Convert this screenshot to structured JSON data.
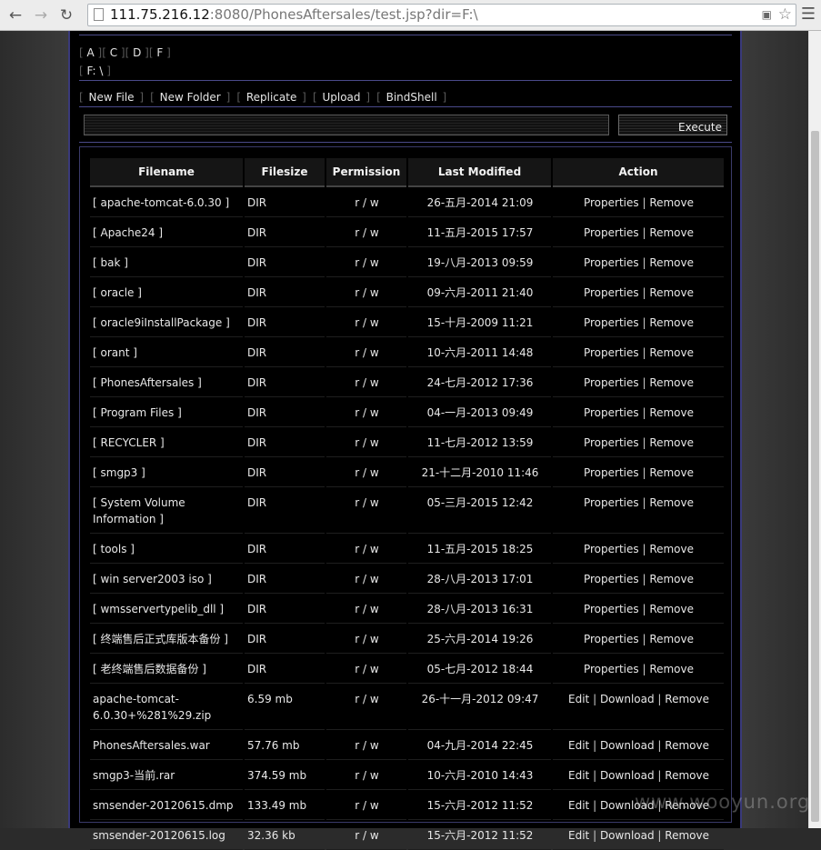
{
  "browser": {
    "url_host": "111.75.216.12",
    "url_rest": ":8080/PhonesAftersales/test.jsp?dir=F:\\",
    "back_icon": "back-arrow-icon",
    "forward_icon": "forward-arrow-icon",
    "reload_icon": "reload-icon",
    "menu_icon": "menu-icon"
  },
  "drives": [
    "A",
    "C",
    "D",
    "F"
  ],
  "current_dir": "F: \\",
  "toolbar": {
    "new_file": "New File",
    "new_folder": "New Folder",
    "replicate": "Replicate",
    "upload": "Upload",
    "bindshell": "BindShell"
  },
  "command": {
    "value": "",
    "execute_label": "Execute"
  },
  "table": {
    "headers": [
      "Filename",
      "Filesize",
      "Permission",
      "Last Modified",
      "Action"
    ],
    "rows": [
      {
        "name": "[ apache-tomcat-6.0.30 ]",
        "size": "DIR",
        "perm": "r / w",
        "modified": "26-五月-2014 21:09",
        "actions": [
          "Properties",
          "Remove"
        ]
      },
      {
        "name": "[ Apache24 ]",
        "size": "DIR",
        "perm": "r / w",
        "modified": "11-五月-2015 17:57",
        "actions": [
          "Properties",
          "Remove"
        ]
      },
      {
        "name": "[ bak ]",
        "size": "DIR",
        "perm": "r / w",
        "modified": "19-八月-2013 09:59",
        "actions": [
          "Properties",
          "Remove"
        ]
      },
      {
        "name": "[ oracle ]",
        "size": "DIR",
        "perm": "r / w",
        "modified": "09-六月-2011 21:40",
        "actions": [
          "Properties",
          "Remove"
        ]
      },
      {
        "name": "[ oracle9iInstallPackage ]",
        "size": "DIR",
        "perm": "r / w",
        "modified": "15-十月-2009 11:21",
        "actions": [
          "Properties",
          "Remove"
        ]
      },
      {
        "name": "[ orant ]",
        "size": "DIR",
        "perm": "r / w",
        "modified": "10-六月-2011 14:48",
        "actions": [
          "Properties",
          "Remove"
        ]
      },
      {
        "name": "[ PhonesAftersales ]",
        "size": "DIR",
        "perm": "r / w",
        "modified": "24-七月-2012 17:36",
        "actions": [
          "Properties",
          "Remove"
        ]
      },
      {
        "name": "[ Program Files ]",
        "size": "DIR",
        "perm": "r / w",
        "modified": "04-一月-2013 09:49",
        "actions": [
          "Properties",
          "Remove"
        ]
      },
      {
        "name": "[ RECYCLER ]",
        "size": "DIR",
        "perm": "r / w",
        "modified": "11-七月-2012 13:59",
        "actions": [
          "Properties",
          "Remove"
        ]
      },
      {
        "name": "[ smgp3 ]",
        "size": "DIR",
        "perm": "r / w",
        "modified": "21-十二月-2010 11:46",
        "actions": [
          "Properties",
          "Remove"
        ]
      },
      {
        "name": "[ System Volume Information ]",
        "size": "DIR",
        "perm": "r / w",
        "modified": "05-三月-2015 12:42",
        "actions": [
          "Properties",
          "Remove"
        ]
      },
      {
        "name": "[ tools ]",
        "size": "DIR",
        "perm": "r / w",
        "modified": "11-五月-2015 18:25",
        "actions": [
          "Properties",
          "Remove"
        ]
      },
      {
        "name": "[ win server2003 iso ]",
        "size": "DIR",
        "perm": "r / w",
        "modified": "28-八月-2013 17:01",
        "actions": [
          "Properties",
          "Remove"
        ]
      },
      {
        "name": "[ wmsservertypelib_dll ]",
        "size": "DIR",
        "perm": "r / w",
        "modified": "28-八月-2013 16:31",
        "actions": [
          "Properties",
          "Remove"
        ]
      },
      {
        "name": "[ 终端售后正式库版本备份 ]",
        "size": "DIR",
        "perm": "r / w",
        "modified": "25-六月-2014 19:26",
        "actions": [
          "Properties",
          "Remove"
        ]
      },
      {
        "name": "[ 老终端售后数据备份 ]",
        "size": "DIR",
        "perm": "r / w",
        "modified": "05-七月-2012 18:44",
        "actions": [
          "Properties",
          "Remove"
        ]
      },
      {
        "name": "apache-tomcat-6.0.30+%281%29.zip",
        "size": "6.59 mb",
        "perm": "r / w",
        "modified": "26-十一月-2012 09:47",
        "actions": [
          "Edit",
          "Download",
          "Remove"
        ]
      },
      {
        "name": "PhonesAftersales.war",
        "size": "57.76 mb",
        "perm": "r / w",
        "modified": "04-九月-2014 22:45",
        "actions": [
          "Edit",
          "Download",
          "Remove"
        ]
      },
      {
        "name": "smgp3-当前.rar",
        "size": "374.59 mb",
        "perm": "r / w",
        "modified": "10-六月-2010 14:43",
        "actions": [
          "Edit",
          "Download",
          "Remove"
        ]
      },
      {
        "name": "smsender-20120615.dmp",
        "size": "133.49 mb",
        "perm": "r / w",
        "modified": "15-六月-2012 11:52",
        "actions": [
          "Edit",
          "Download",
          "Remove"
        ]
      },
      {
        "name": "smsender-20120615.log",
        "size": "32.36 kb",
        "perm": "r / w",
        "modified": "15-六月-2012 11:52",
        "actions": [
          "Edit",
          "Download",
          "Remove"
        ]
      }
    ]
  },
  "watermark": "www.wooyun.org"
}
